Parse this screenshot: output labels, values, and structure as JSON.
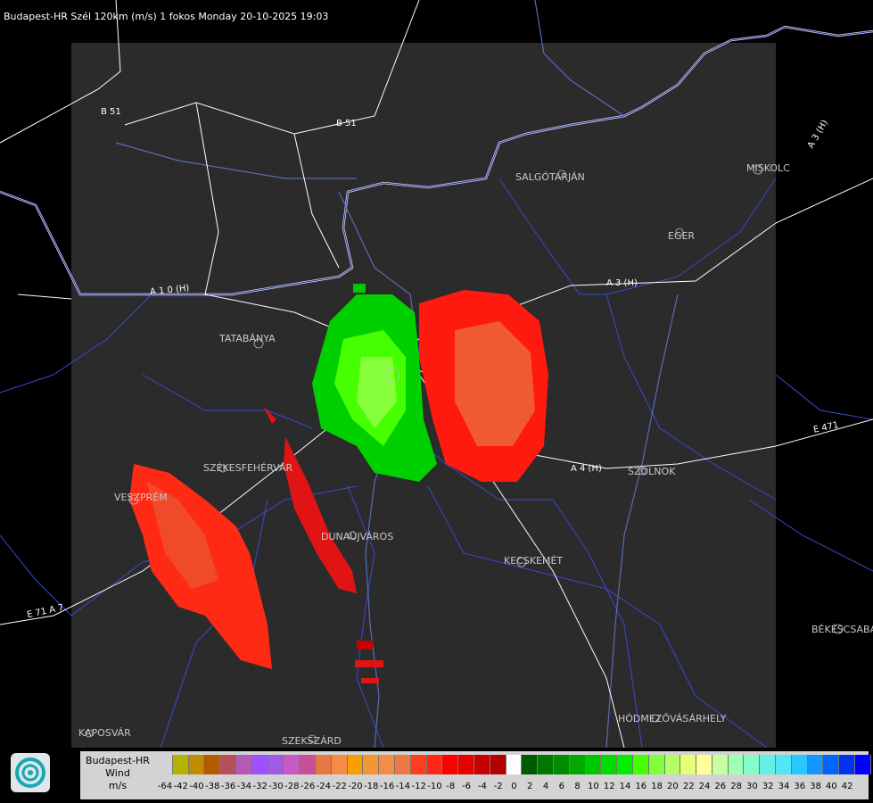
{
  "header": {
    "title": "Budapest-HR Szél 120km (m/s) 1 fokos Monday 20-10-2025 19:03"
  },
  "cities": [
    "SALGÓTARJÁN",
    "MISKOLC",
    "EGER",
    "TATABÁNYA",
    "SZÉKESFEHÉRVÁR",
    "VESZPRÉM",
    "DUNAÚJVÁROS",
    "KECSKEMÉT",
    "SZOLNOK",
    "BÉKÉSCSABA",
    "HÓDMEZŐVÁSÁRHELY",
    "KAPOSVÁR",
    "SZEKSZÁRD"
  ],
  "roads": [
    "B 51",
    "B 51",
    "A 3 (H)",
    "A 3 (H)",
    "A 4 (H)",
    "E 471",
    "A 1 0 (H)",
    "E 71 A 7"
  ],
  "legend": {
    "title_lines": [
      "Budapest-HR",
      "Wind",
      "m/s"
    ],
    "colors": [
      "#d4d4d4",
      "#b4b400",
      "#c08c00",
      "#b45a00",
      "#b4505a",
      "#b45ab4",
      "#a050ff",
      "#a05ae6",
      "#c85ac8",
      "#c8509a",
      "#e67846",
      "#f58c46",
      "#f5a000",
      "#f59632",
      "#f58c46",
      "#f07846",
      "#ff3c1e",
      "#ff2814",
      "#ff0000",
      "#e60000",
      "#c80000",
      "#b40000",
      "#ffffff",
      "#005a00",
      "#007800",
      "#008c00",
      "#00aa00",
      "#00c800",
      "#00dc00",
      "#00f000",
      "#46ff00",
      "#82ff3c",
      "#b4ff64",
      "#e6ff78",
      "#ffff96",
      "#c8ffa0",
      "#a0ffb4",
      "#82ffc8",
      "#64f0e6",
      "#50e6f5",
      "#28c8ff",
      "#1496ff",
      "#0064ff",
      "#0032f0",
      "#0000ff"
    ],
    "labels": [
      "-64",
      "-42",
      "-40",
      "-38",
      "-36",
      "-34",
      "-32",
      "-30",
      "-28",
      "-26",
      "-24",
      "-22",
      "-20",
      "-18",
      "-16",
      "-14",
      "-12",
      "-10",
      "-8",
      "-6",
      "-4",
      "-2",
      "0",
      "2",
      "4",
      "6",
      "8",
      "10",
      "12",
      "14",
      "16",
      "18",
      "20",
      "22",
      "24",
      "26",
      "28",
      "30",
      "32",
      "34",
      "36",
      "38",
      "40",
      "42"
    ]
  }
}
